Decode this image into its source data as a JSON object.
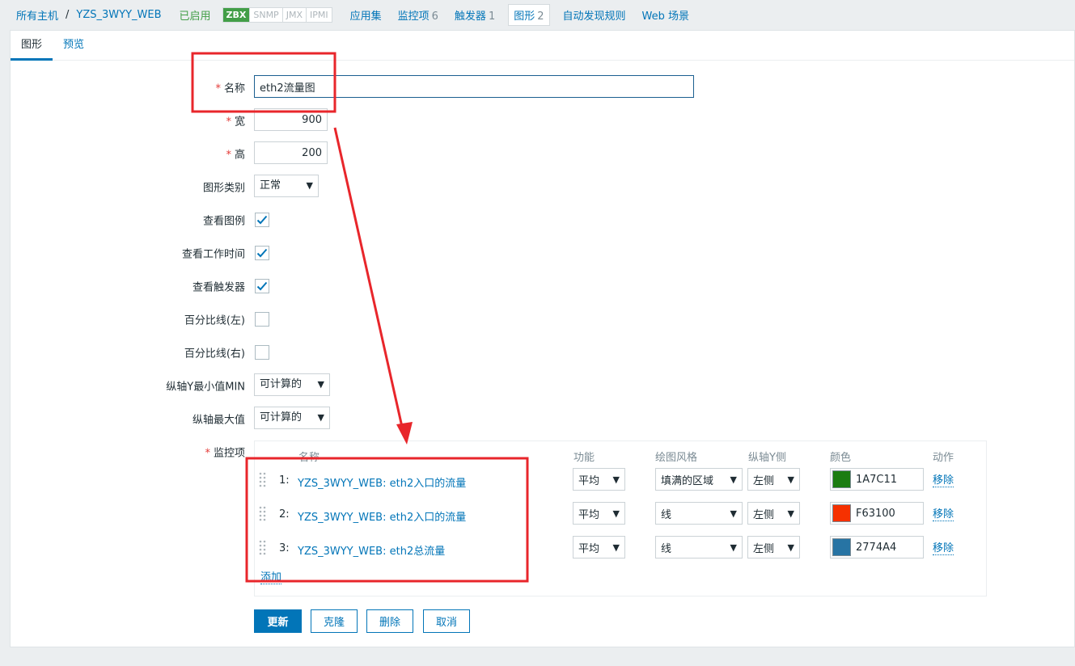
{
  "breadcrumb": {
    "all_hosts": "所有主机",
    "separator": "/",
    "host": "YZS_3WYY_WEB",
    "status": "已启用"
  },
  "availability": [
    "ZBX",
    "SNMP",
    "JMX",
    "IPMI"
  ],
  "nav": {
    "applications": "应用集",
    "items": "监控项",
    "items_count": "6",
    "triggers": "触发器",
    "triggers_count": "1",
    "graphs": "图形",
    "graphs_count": "2",
    "discovery": "自动发现规则",
    "web": "Web 场景"
  },
  "tabs": [
    "图形",
    "预览"
  ],
  "form": {
    "name_label": "名称",
    "name_value": "eth2流量图",
    "width_label": "宽",
    "width_value": "900",
    "height_label": "高",
    "height_value": "200",
    "graph_type_label": "图形类别",
    "graph_type_value": "正常",
    "show_legend_label": "查看图例",
    "show_working_time_label": "查看工作时间",
    "show_triggers_label": "查看触发器",
    "percentile_left_label": "百分比线(左)",
    "percentile_right_label": "百分比线(右)",
    "ymin_label": "纵轴Y最小值MIN",
    "ymin_value": "可计算的",
    "ymax_label": "纵轴最大值",
    "ymax_value": "可计算的",
    "items_label": "监控项"
  },
  "items_table": {
    "headers": {
      "name": "名称",
      "function": "功能",
      "draw_style": "绘图风格",
      "y_side": "纵轴Y侧",
      "color": "颜色",
      "action": "动作"
    },
    "rows": [
      {
        "index": "1:",
        "name": "YZS_3WYY_WEB: eth2入口的流量",
        "function": "平均",
        "style": "填满的区域",
        "side": "左侧",
        "color": "1A7C11",
        "action": "移除"
      },
      {
        "index": "2:",
        "name": "YZS_3WYY_WEB: eth2入口的流量",
        "function": "平均",
        "style": "线",
        "side": "左侧",
        "color": "F63100",
        "action": "移除"
      },
      {
        "index": "3:",
        "name": "YZS_3WYY_WEB: eth2总流量",
        "function": "平均",
        "style": "线",
        "side": "左侧",
        "color": "2774A4",
        "action": "移除"
      }
    ],
    "add_link": "添加"
  },
  "buttons": {
    "update": "更新",
    "clone": "克隆",
    "delete": "删除",
    "cancel": "取消"
  },
  "colors": {
    "link": "#0275b8",
    "enabled": "#429e47",
    "annotation": "#e8262b"
  }
}
